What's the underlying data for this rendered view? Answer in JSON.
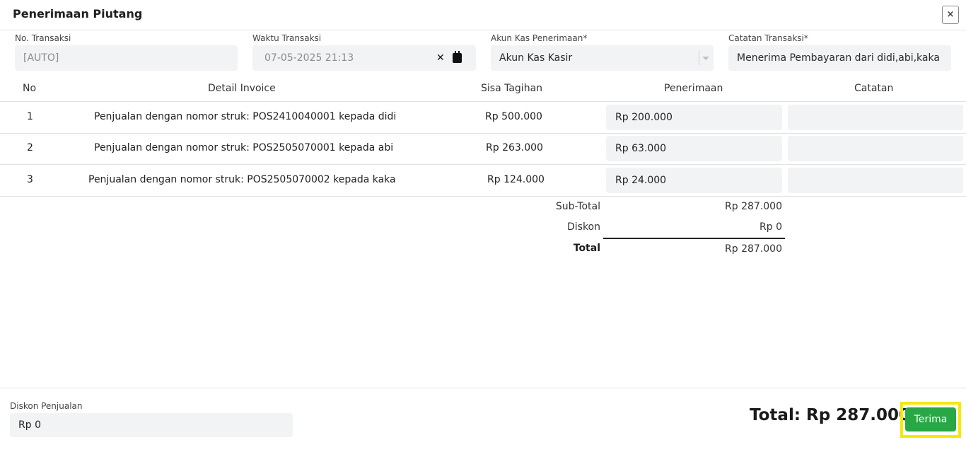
{
  "modal": {
    "title": "Penerimaan Piutang",
    "close_label": "×"
  },
  "form": {
    "no_transaksi": {
      "label": "No. Transaksi",
      "value": "[AUTO]"
    },
    "waktu_transaksi": {
      "label": "Waktu Transaksi",
      "value": "07-05-2025 21:13"
    },
    "akun_kas": {
      "label": "Akun Kas Penerimaan*",
      "value": "Akun Kas Kasir"
    },
    "catatan_transaksi": {
      "label": "Catatan Transaksi*",
      "value": "Menerima Pembayaran dari didi,abi,kaka"
    }
  },
  "table": {
    "headers": {
      "no": "No",
      "detail": "Detail Invoice",
      "sisa": "Sisa Tagihan",
      "penerimaan": "Penerimaan",
      "catatan": "Catatan"
    },
    "rows": [
      {
        "no": "1",
        "detail": "Penjualan dengan nomor struk: POS2410040001 kepada didi",
        "sisa": "Rp 500.000",
        "penerimaan": "Rp 200.000",
        "catatan": ""
      },
      {
        "no": "2",
        "detail": "Penjualan dengan nomor struk: POS2505070001 kepada abi",
        "sisa": "Rp 263.000",
        "penerimaan": "Rp 63.000",
        "catatan": ""
      },
      {
        "no": "3",
        "detail": "Penjualan dengan nomor struk: POS2505070002 kepada kaka",
        "sisa": "Rp 124.000",
        "penerimaan": "Rp 24.000",
        "catatan": ""
      }
    ]
  },
  "summary": {
    "subtotal_label": "Sub-Total",
    "subtotal_value": "Rp 287.000",
    "diskon_label": "Diskon",
    "diskon_value": "Rp 0",
    "total_label": "Total",
    "total_value": "Rp 287.000"
  },
  "footer": {
    "diskon_penjualan_label": "Diskon Penjualan",
    "diskon_penjualan_value": "Rp 0",
    "grand_total": "Total: Rp 287.000",
    "submit_label": "Terima"
  },
  "icons": [
    "close-icon",
    "clear-icon",
    "calendar-icon",
    "dropdown-caret-icon"
  ],
  "colors": {
    "submit_button": "#28a745",
    "highlight": "#f3ea00",
    "field_bg": "#f2f3f5"
  }
}
